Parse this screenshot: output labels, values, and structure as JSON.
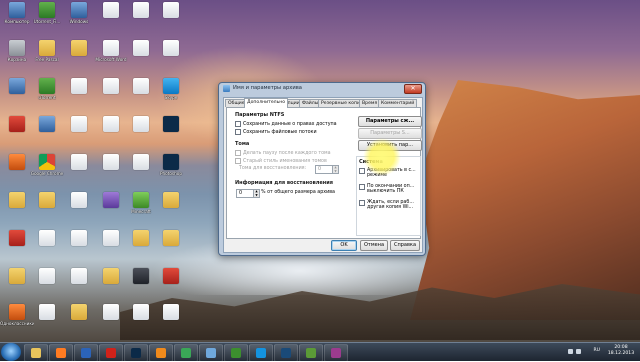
{
  "desktop": {
    "icons": [
      {
        "label": "Компьютер",
        "icon": "computer-icon",
        "kind": "k-exe"
      },
      {
        "label": "Utorrent_Fi...",
        "icon": "torrent-icon",
        "kind": "k-torrent"
      },
      {
        "label": "Windows",
        "icon": "windows-icon",
        "kind": "k-exe"
      },
      {
        "label": "",
        "icon": "document-icon",
        "kind": "k-doc"
      },
      {
        "label": "",
        "icon": "document-icon",
        "kind": "k-doc"
      },
      {
        "label": "",
        "icon": "document-icon",
        "kind": "k-doc"
      },
      {
        "label": "Корзина",
        "icon": "recycle-bin-icon",
        "kind": "k-gray"
      },
      {
        "label": "Free Pascal",
        "icon": "folder-icon",
        "kind": "k-folder"
      },
      {
        "label": "",
        "icon": "folder-icon",
        "kind": "k-folder"
      },
      {
        "label": "Microsoft Word",
        "icon": "word-icon",
        "kind": "k-doc"
      },
      {
        "label": "",
        "icon": "document-icon",
        "kind": "k-doc"
      },
      {
        "label": "",
        "icon": "document-icon",
        "kind": "k-doc"
      },
      {
        "label": "",
        "icon": "network-icon",
        "kind": "k-exe"
      },
      {
        "label": "uTorrent",
        "icon": "torrent-icon",
        "kind": "k-torrent"
      },
      {
        "label": "",
        "icon": "document-icon",
        "kind": "k-doc"
      },
      {
        "label": "",
        "icon": "abc-icon",
        "kind": "k-doc"
      },
      {
        "label": "",
        "icon": "document-icon",
        "kind": "k-doc"
      },
      {
        "label": "Skype",
        "icon": "skype-icon",
        "kind": "k-skype"
      },
      {
        "label": "",
        "icon": "media-icon",
        "kind": "k-red"
      },
      {
        "label": "",
        "icon": "exe-icon",
        "kind": "k-exe"
      },
      {
        "label": "",
        "icon": "document-icon",
        "kind": "k-doc"
      },
      {
        "label": "",
        "icon": "abc-icon",
        "kind": "k-doc"
      },
      {
        "label": "",
        "icon": "document-icon",
        "kind": "k-doc"
      },
      {
        "label": "",
        "icon": "photoshop-icon",
        "kind": "k-ps"
      },
      {
        "label": "",
        "icon": "media-player-icon",
        "kind": "k-media"
      },
      {
        "label": "Google Chrome",
        "icon": "chrome-icon",
        "kind": "k-chrome"
      },
      {
        "label": "",
        "icon": "document-icon",
        "kind": "k-doc"
      },
      {
        "label": "",
        "icon": "document-icon",
        "kind": "k-doc"
      },
      {
        "label": "",
        "icon": "document-icon",
        "kind": "k-doc"
      },
      {
        "label": "Photoshop",
        "icon": "photoshop-icon",
        "kind": "k-ps"
      },
      {
        "label": "",
        "icon": "folder-icon",
        "kind": "k-folder"
      },
      {
        "label": "",
        "icon": "folder-icon",
        "kind": "k-folder"
      },
      {
        "label": "",
        "icon": "document-icon",
        "kind": "k-doc"
      },
      {
        "label": "",
        "icon": "calendar-icon",
        "kind": "k-purple"
      },
      {
        "label": "Minecraft",
        "icon": "minecraft-icon",
        "kind": "k-green"
      },
      {
        "label": "",
        "icon": "folder-icon",
        "kind": "k-folder"
      },
      {
        "label": "",
        "icon": "archive-icon",
        "kind": "k-red"
      },
      {
        "label": "",
        "icon": "document-icon",
        "kind": "k-doc"
      },
      {
        "label": "",
        "icon": "document-icon",
        "kind": "k-doc"
      },
      {
        "label": "",
        "icon": "document-icon",
        "kind": "k-doc"
      },
      {
        "label": "",
        "icon": "folder-icon",
        "kind": "k-folder"
      },
      {
        "label": "",
        "icon": "folder-icon",
        "kind": "k-folder"
      },
      {
        "label": "",
        "icon": "folder-icon",
        "kind": "k-folder"
      },
      {
        "label": "",
        "icon": "document-icon",
        "kind": "k-doc"
      },
      {
        "label": "",
        "icon": "document-icon",
        "kind": "k-doc"
      },
      {
        "label": "",
        "icon": "folder-icon",
        "kind": "k-folder"
      },
      {
        "label": "",
        "icon": "bee-icon",
        "kind": "k-dark"
      },
      {
        "label": "",
        "icon": "cube-icon",
        "kind": "k-red"
      },
      {
        "label": "Одноклассники",
        "icon": "ok-icon",
        "kind": "k-media"
      },
      {
        "label": "",
        "icon": "document-icon",
        "kind": "k-doc"
      },
      {
        "label": "",
        "icon": "folder-icon",
        "kind": "k-folder"
      },
      {
        "label": "",
        "icon": "document-icon",
        "kind": "k-doc"
      },
      {
        "label": "",
        "icon": "document-icon",
        "kind": "k-doc"
      },
      {
        "label": "",
        "icon": "document-icon",
        "kind": "k-doc"
      },
      {
        "label": "",
        "icon": "folder-icon",
        "kind": "k-folder"
      }
    ]
  },
  "dialog": {
    "title": "Имя и параметры архива",
    "tabs": [
      "Общие",
      "Дополнительно",
      "Опции",
      "Файлы",
      "Резервные копии",
      "Время",
      "Комментарий"
    ],
    "active_tab": 1,
    "ntfs": {
      "heading": "Параметры NTFS",
      "options": [
        "Сохранить данные о правах доступа",
        "Сохранить файловые потоки"
      ]
    },
    "volumes": {
      "heading": "Тома",
      "options": [
        "Делать паузу после каждого тома",
        "Старый стиль именования томов"
      ],
      "recovery_label": "Тома для восстановления:",
      "recovery_value": "0"
    },
    "recovery_info": {
      "heading": "Информация для восстановления",
      "value": "0",
      "suffix": "% от общего размера архива"
    },
    "right_buttons": [
      "Параметры сж...",
      "Параметры S...",
      "Установить пар..."
    ],
    "system": {
      "heading": "Система",
      "options": [
        "Архивировать в с... режиме",
        "По окончании оп... выключить ПК",
        "Ждать, если раб... другая копия Wi..."
      ]
    },
    "buttons": {
      "ok": "OK",
      "cancel": "Отмена",
      "help": "Справка"
    },
    "close_glyph": "✕"
  },
  "taskbar": {
    "language": "RU",
    "time": "20:08",
    "date": "18.12.2013",
    "pinned": [
      {
        "icon": "explorer-icon",
        "color": "#e8c45c"
      },
      {
        "icon": "media-player-icon",
        "color": "#ff7b22"
      },
      {
        "icon": "word-icon",
        "color": "#2b63b8"
      },
      {
        "icon": "acrobat-icon",
        "color": "#d0221a"
      },
      {
        "icon": "photoshop-icon",
        "color": "#0b2a48"
      },
      {
        "icon": "firefox-icon",
        "color": "#f08a1c"
      },
      {
        "icon": "chrome-icon",
        "color": "#3aa757"
      },
      {
        "icon": "paint-icon",
        "color": "#6fa8dc"
      },
      {
        "icon": "torrent-icon",
        "color": "#3c8f2e"
      },
      {
        "icon": "skype-icon",
        "color": "#1493e0"
      },
      {
        "icon": "photoshop-icon",
        "color": "#1a4a78"
      },
      {
        "icon": "minecraft-icon",
        "color": "#5b9a37"
      },
      {
        "icon": "winrar-icon",
        "color": "#9b3b8e"
      }
    ]
  }
}
